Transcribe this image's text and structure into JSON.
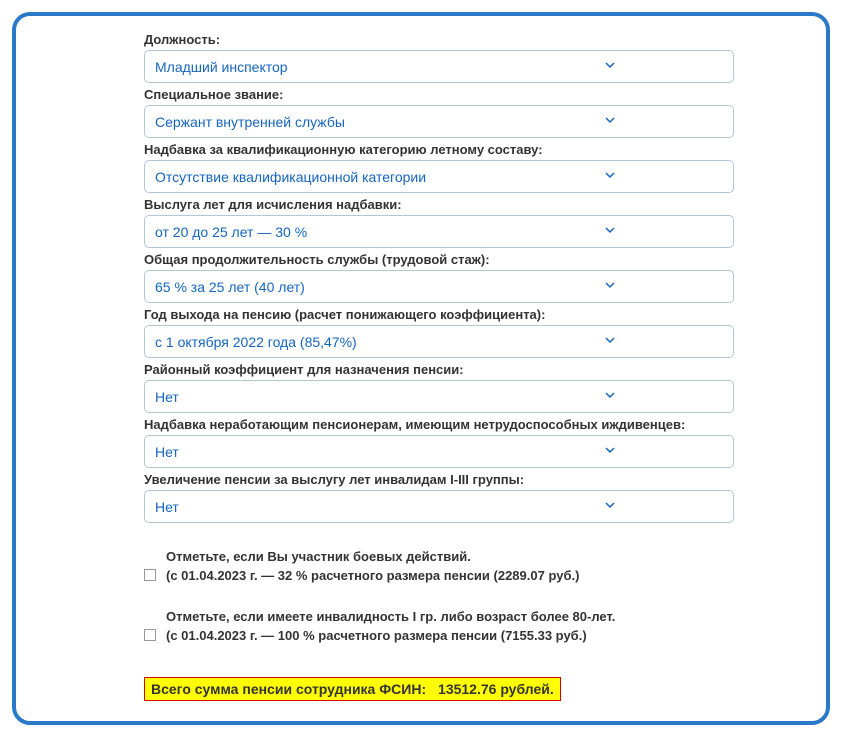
{
  "fields": [
    {
      "label": "Должность:",
      "value": "Младший инспектор"
    },
    {
      "label": "Специальное звание:",
      "value": "Сержант внутренней службы"
    },
    {
      "label": "Надбавка за квалификационную категорию летному составу:",
      "value": "Отсутствие квалификационной категории"
    },
    {
      "label": "Выслуга лет для исчисления надбавки:",
      "value": "от 20 до 25 лет — 30 %"
    },
    {
      "label": "Общая продолжительность службы (трудовой стаж):",
      "value": "65 % за 25 лет (40 лет)"
    },
    {
      "label": "Год выхода на пенсию (расчет понижающего коэффициента):",
      "value": "с 1 октября 2022 года (85,47%)"
    },
    {
      "label": "Районный коэффициент для назначения пенсии:",
      "value": "Нет"
    },
    {
      "label": "Надбавка неработающим пенсионерам, имеющим нетрудоспособных иждивенцев:",
      "value": "Нет"
    },
    {
      "label": "Увеличение пенсии за выслугу лет инвалидам I-III группы:",
      "value": "Нет"
    }
  ],
  "checkboxes": [
    {
      "title": "Отметьте, если Вы участник боевых действий.",
      "sub": "(с 01.04.2023 г. — 32 % расчетного размера пенсии (2289.07 руб.)"
    },
    {
      "title": "Отметьте, если имеете инвалидность I гр. либо возраст более 80-лет.",
      "sub": "(с 01.04.2023 г. — 100 % расчетного размера пенсии (7155.33 руб.)"
    }
  ],
  "result": {
    "label": "Всего сумма пенсии сотрудника ФСИН:",
    "value": "13512.76 рублей."
  }
}
